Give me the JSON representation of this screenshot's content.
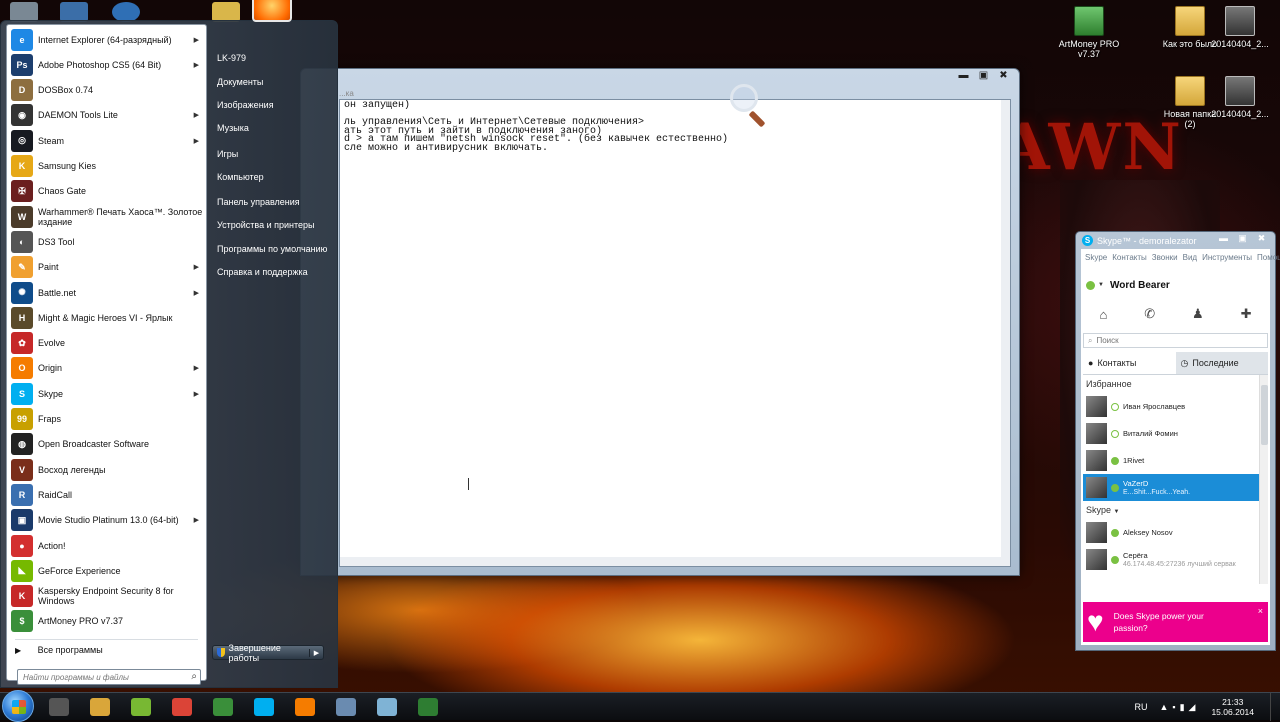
{
  "colors": {
    "skype_blue": "#00aff0",
    "skype_selected": "#1b8dd7",
    "skype_ad": "#ec008c",
    "online": "#7ac142"
  },
  "wallpaper": {
    "title": "AWN"
  },
  "desktop_icons": [
    {
      "label": "ArtMoney PRO v7.37",
      "icon": "artmoney-icon"
    },
    {
      "label": "Как это было",
      "icon": "folder-icon"
    },
    {
      "label": "20140404_2...",
      "icon": "photo-icon"
    },
    {
      "label": "Новая папка (2)",
      "icon": "folder-icon"
    },
    {
      "label": "20140404_2...",
      "icon": "photo-icon"
    }
  ],
  "console": {
    "path_hint": "...ка",
    "lines": [
      "он запущен)",
      "",
      "ль управления\\Сеть и Интернет\\Сетевые подключения>",
      "ать этот путь и зайти в подключения заного)",
      "d > а там пишем \"netsh winsock reset\". (без кавычек естественно)",
      "сле можно и антивирусник включать."
    ],
    "controls": {
      "minimize": "▬",
      "maximize": "▣",
      "close": "✖"
    }
  },
  "start_menu": {
    "programs": [
      {
        "label": "Internet Explorer (64-разрядный)",
        "icon": "internet-explorer-icon",
        "color": "#1e88e5",
        "glyph": "e",
        "arrow": true
      },
      {
        "label": "Adobe Photoshop CS5 (64 Bit)",
        "icon": "photoshop-icon",
        "color": "#1c3e6e",
        "glyph": "Ps",
        "arrow": true
      },
      {
        "label": "DOSBox 0.74",
        "icon": "dosbox-icon",
        "color": "#8d6e3f",
        "glyph": "D",
        "arrow": false
      },
      {
        "label": "DAEMON Tools Lite",
        "icon": "daemon-tools-icon",
        "color": "#333",
        "glyph": "◉",
        "arrow": true
      },
      {
        "label": "Steam",
        "icon": "steam-icon",
        "color": "#171a21",
        "glyph": "◎",
        "arrow": true
      },
      {
        "label": "Samsung Kies",
        "icon": "samsung-kies-icon",
        "color": "#e6a817",
        "glyph": "K",
        "arrow": false
      },
      {
        "label": "Chaos Gate",
        "icon": "chaos-gate-icon",
        "color": "#6b1f1f",
        "glyph": "✠",
        "arrow": false
      },
      {
        "label": "Warhammer® Печать Хаоса™. Золотое издание",
        "icon": "warhammer-icon",
        "color": "#4b3b2a",
        "glyph": "W",
        "arrow": false
      },
      {
        "label": "DS3 Tool",
        "icon": "ds3-tool-icon",
        "color": "#555",
        "glyph": "◐",
        "arrow": false
      },
      {
        "label": "Paint",
        "icon": "paint-icon",
        "color": "#f0a030",
        "glyph": "✎",
        "arrow": true
      },
      {
        "label": "Battle.net",
        "icon": "battlenet-icon",
        "color": "#0f4c8a",
        "glyph": "✺",
        "arrow": true
      },
      {
        "label": "Might & Magic Heroes VI - Ярлык",
        "icon": "heroes-icon",
        "color": "#5a4a2a",
        "glyph": "H",
        "arrow": false
      },
      {
        "label": "Evolve",
        "icon": "evolve-icon",
        "color": "#c62828",
        "glyph": "✿",
        "arrow": false
      },
      {
        "label": "Origin",
        "icon": "origin-icon",
        "color": "#f57c00",
        "glyph": "O",
        "arrow": true
      },
      {
        "label": "Skype",
        "icon": "skype-icon",
        "color": "#00aff0",
        "glyph": "S",
        "arrow": true
      },
      {
        "label": "Fraps",
        "icon": "fraps-icon",
        "color": "#c8a000",
        "glyph": "99",
        "arrow": false
      },
      {
        "label": "Open Broadcaster Software",
        "icon": "obs-icon",
        "color": "#222",
        "glyph": "◍",
        "arrow": false
      },
      {
        "label": "Восход легенды",
        "icon": "voshod-icon",
        "color": "#7a2e1a",
        "glyph": "V",
        "arrow": false
      },
      {
        "label": "RaidCall",
        "icon": "raidcall-icon",
        "color": "#3a6fb0",
        "glyph": "R",
        "arrow": false
      },
      {
        "label": "Movie Studio Platinum 13.0 (64-bit)",
        "icon": "movie-studio-icon",
        "color": "#1a3a6a",
        "glyph": "▣",
        "arrow": true
      },
      {
        "label": "Action!",
        "icon": "action-icon",
        "color": "#d32f2f",
        "glyph": "●",
        "arrow": false
      },
      {
        "label": "GeForce Experience",
        "icon": "geforce-icon",
        "color": "#76b900",
        "glyph": "◣",
        "arrow": false
      },
      {
        "label": "Kaspersky Endpoint Security 8 for Windows",
        "icon": "kaspersky-icon",
        "color": "#c62828",
        "glyph": "K",
        "arrow": false
      },
      {
        "label": "ArtMoney PRO v7.37",
        "icon": "artmoney-icon",
        "color": "#3a8f3a",
        "glyph": "$",
        "arrow": false
      }
    ],
    "all_programs": "Все программы",
    "search_placeholder": "Найти программы и файлы",
    "right_links": [
      {
        "label": "LK-979",
        "name": "user-name-link"
      },
      {
        "label": "Документы",
        "name": "documents-link"
      },
      {
        "label": "Изображения",
        "name": "pictures-link"
      },
      {
        "label": "Музыка",
        "name": "music-link"
      },
      {
        "label": "Игры",
        "name": "games-link"
      },
      {
        "label": "Компьютер",
        "name": "computer-link"
      },
      {
        "label": "Панель управления",
        "name": "control-panel-link"
      },
      {
        "label": "Устройства и принтеры",
        "name": "devices-printers-link"
      },
      {
        "label": "Программы по умолчанию",
        "name": "default-programs-link"
      },
      {
        "label": "Справка и поддержка",
        "name": "help-support-link"
      }
    ],
    "shutdown_label": "Завершение работы"
  },
  "skype": {
    "title": "Skype™ - demoralezator",
    "menu": [
      "Skype",
      "Контакты",
      "Звонки",
      "Вид",
      "Инструменты",
      "Помощь"
    ],
    "user": "Word Bearer",
    "search_placeholder": "Поиск",
    "tabs": [
      "Контакты",
      "Последние"
    ],
    "favorites_header": "Избранное",
    "skype_header": "Skype",
    "favorites": [
      {
        "name": "Иван Ярославцев",
        "sub": "",
        "online": false
      },
      {
        "name": "Виталий Фомин",
        "sub": "",
        "online": false
      },
      {
        "name": "1Rivet",
        "sub": "",
        "online": true
      },
      {
        "name": "VaZerD",
        "sub": "E...Shit...Fuck...Yeah.",
        "online": true,
        "selected": true
      }
    ],
    "contacts": [
      {
        "name": "Aleksey Nosov",
        "sub": "",
        "online": true
      },
      {
        "name": "Серёга",
        "sub": "46.174.48.45:27236 лучший сервак",
        "online": true
      }
    ],
    "ad_text": "Does Skype power your passion?",
    "ad_close": "×"
  },
  "taskbar": {
    "apps": [
      {
        "icon": "winamp-icon",
        "color": "#555"
      },
      {
        "icon": "explorer-folder-icon",
        "color": "#d9a63a"
      },
      {
        "icon": "utorrent-icon",
        "color": "#78b833"
      },
      {
        "icon": "chrome-icon",
        "color": "#db4437"
      },
      {
        "icon": "camtasia-icon",
        "color": "#3a8f3a"
      },
      {
        "icon": "skype-icon",
        "color": "#00aff0"
      },
      {
        "icon": "origin-icon",
        "color": "#f57c00"
      },
      {
        "icon": "network-icon",
        "color": "#6a8bb0"
      },
      {
        "icon": "notepad-icon",
        "color": "#7fb3d5"
      },
      {
        "icon": "camtasia-recorder-icon",
        "color": "#2e7d32"
      }
    ],
    "lang": "RU",
    "time": "21:33",
    "date": "15.06.2014"
  }
}
